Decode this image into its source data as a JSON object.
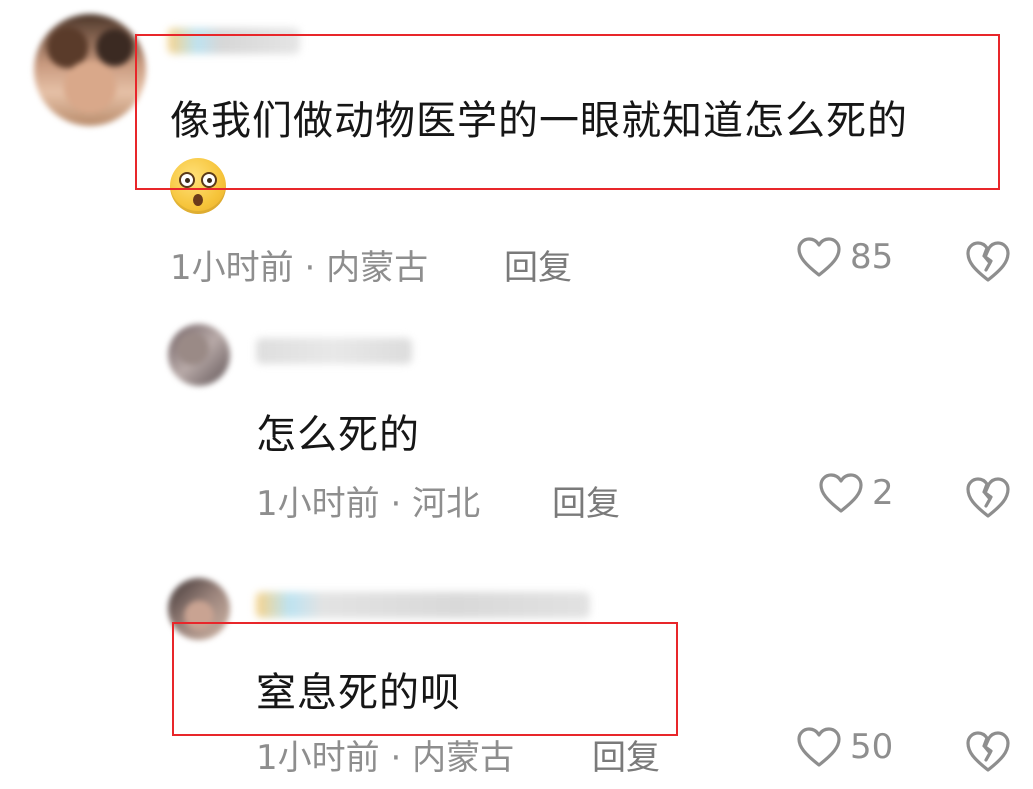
{
  "main_comment": {
    "text": "像我们做动物医学的一眼就知道怎么死的",
    "emoji": "astonished-face-emoji",
    "time": "1小时前",
    "location": "内蒙古",
    "meta_separator": " · ",
    "reply_label": "回复",
    "likes": "85"
  },
  "replies": [
    {
      "text": "怎么死的",
      "time": "1小时前",
      "location": "河北",
      "reply_label": "回复",
      "likes": "2"
    },
    {
      "text": "窒息死的呗",
      "time": "1小时前",
      "location": "内蒙古",
      "reply_label": "回复",
      "likes": "50"
    }
  ],
  "colors": {
    "highlight": "#e8262a",
    "text": "#161616",
    "meta": "#8e8e8e"
  }
}
